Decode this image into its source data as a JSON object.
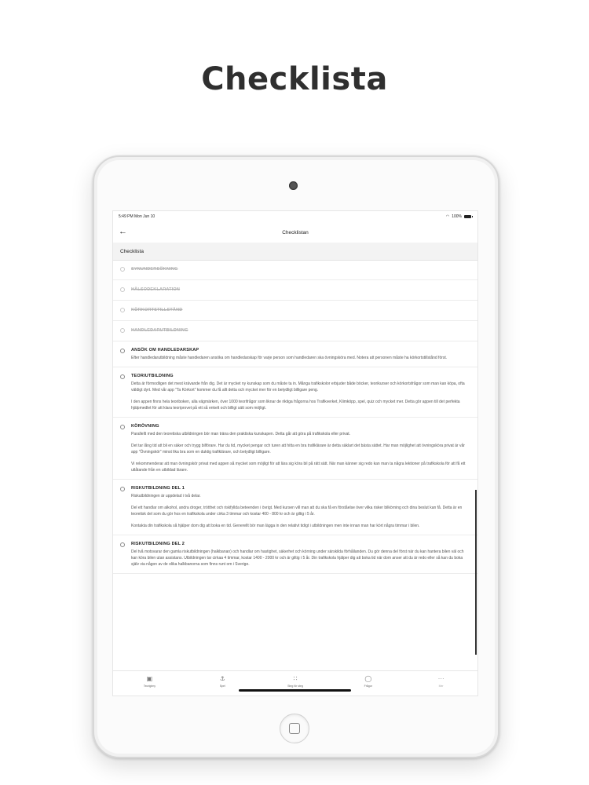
{
  "page": {
    "title": "Checklista"
  },
  "status_bar": {
    "time": "5:49 PM  Mon Jun 10",
    "battery": "100%"
  },
  "nav": {
    "title": "Checklistan"
  },
  "section": {
    "header": "Checklista"
  },
  "done_items": [
    {
      "label": "SYNUNDERSÖKNING"
    },
    {
      "label": "HÄLSODEKLARATION"
    },
    {
      "label": "KÖRKORTSTILLSTÅND"
    },
    {
      "label": "HANDLEDARUTBILDNING"
    }
  ],
  "items": [
    {
      "label": "ANSÖK OM HANDLEDARSKAP",
      "paragraphs": [
        "Efter handledarutbildning måste handledaren ansöka om handledarskap för varje person som handledaren ska övningsköra med. Notera att personen måste ha körkortstillstånd först."
      ]
    },
    {
      "label": "TEORIUTBILDNING",
      "paragraphs": [
        "Detta är förmodligen det mest krävande från dig. Det är mycket ny kunskap som du måste ta in. Många trafikskolor erbjuder både böcker, teorikurser och körkortsfrågor som man kan köpa, ofta väldigt dyrt. Med vår app \"Ta Körkort\" kommer du få allt detta och mycket mer för en betydligt billigare peng.",
        "I den appen finns hela teoriboken, alla vägmärken, över 1000 teorifrågor som liknar de riktiga frågorna hos Trafikverket, Klimköpp, spel, quiz och mycket mer. Detta gör appen till det perfekta hjälpmedlet för att klara teoriprovet på ett så enkelt och billigt sätt som möjligt."
      ]
    },
    {
      "label": "KÖRÖVNING",
      "paragraphs": [
        "Parallellt med den teoretiska utbildningen bör man träna den praktiska kunskapen. Detta går att göra på trafikskola eller privat.",
        "Det tar lång tid att bli en säker och trygg bilförare. Har du tid, mycket pengar och turen att hitta en bra trafiklärare är detta säklart det bästa sättet. Har man möjlighet att övningsköra privat är vår app \"Övningskör\" minst lika bra som en duktig trafiklärare, och betydligt billigare.",
        "Vi rekommenderar att man övningskör privat med appen så mycket som möjligt för att lära sig köra bil på rätt sätt. När man känner sig redo kan man ta några lektioner på trafikskola för att få ett utlåtande från en utbildad lärare."
      ]
    },
    {
      "label": "RISKUTBILDNING DEL 1",
      "paragraphs": [
        "Riskutbildningen är uppdelad i två delar.",
        "Del ett handlar om alkohol, andra droger, trötthet och riskfyllda beteenden i övrigt. Med kursen vill man att du ska få en förståelse över vilka risker bilkörning och dina beslut kan få. Detta är en teoretisk del som du gör hos en trafikskola under cirka 3 timmar och kostar 400 - 800 kr och är giltig i 5 år.",
        "Kontakta din trafikskola så hjälper dom dig att boka en tid. Generellt bör man lägga in den relativt tidigt i utbildningen men inte innan man har kört några timmar i bilen."
      ]
    },
    {
      "label": "RISKUTBILDNING DEL 2",
      "paragraphs": [
        "Del två motsvarar den gamla riskutbildningen (halkbanan) och handlar om hastighet, säkerhet och körning under särskilda förhållanden. Du gör denna del först när du kan hantera bilen väl och kan köra bilen utan assistans. Utbildningen tar cirkaa 4 timmar, kostar 1400 - 2000 kr och är giltig i 5 år. Din trafikskola hjälper dig att boka tid när dom anser att du är redo eller så kan du boka själv via någon av de olika halkbanorna som finns runt om i Sverige."
      ]
    }
  ],
  "tabs": [
    {
      "label": "Teorigtmy",
      "icon": "clipboard-icon"
    },
    {
      "label": "Spel",
      "icon": "anchor-icon"
    },
    {
      "label": "Steg för steg",
      "icon": "steps-icon"
    },
    {
      "label": "Frågor",
      "icon": "chat-icon"
    },
    {
      "label": "Mer",
      "icon": "more-icon"
    }
  ]
}
